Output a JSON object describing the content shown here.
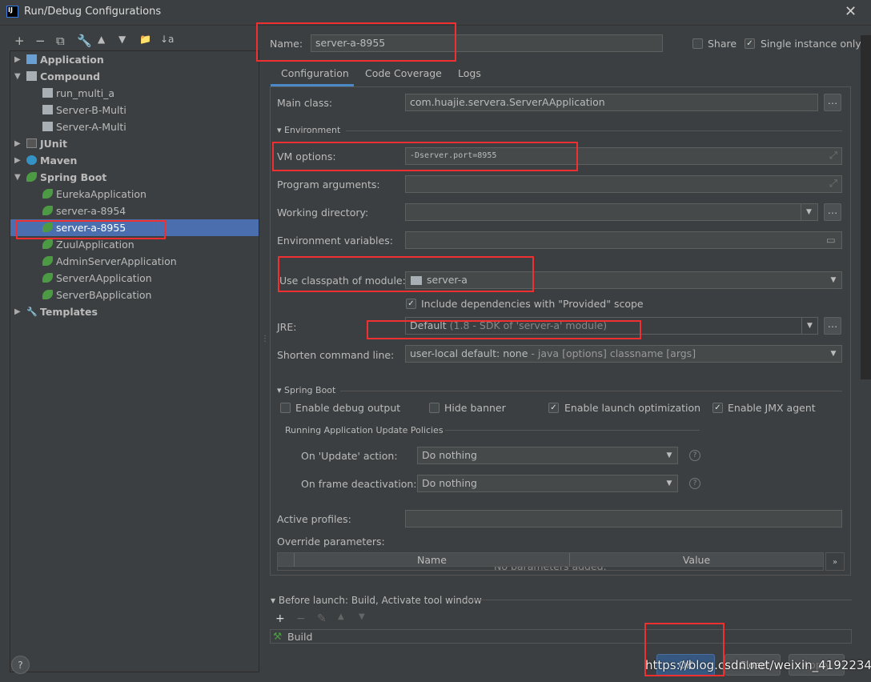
{
  "window": {
    "title": "Run/Debug Configurations",
    "logo": "IJ"
  },
  "toolbar": [
    "+",
    "−",
    "⧉",
    "🔧",
    "▲",
    "▼",
    "📁",
    "↓a"
  ],
  "tree": [
    {
      "label": "Application",
      "level": 0,
      "bold": true,
      "expanded": false,
      "icon": "application-icon"
    },
    {
      "label": "Compound",
      "level": 0,
      "bold": true,
      "expanded": true,
      "icon": "compound-icon"
    },
    {
      "label": "run_multi_a",
      "level": 1,
      "icon": "compound-icon"
    },
    {
      "label": "Server-B-Multi",
      "level": 1,
      "icon": "compound-icon"
    },
    {
      "label": "Server-A-Multi",
      "level": 1,
      "icon": "compound-icon"
    },
    {
      "label": "JUnit",
      "level": 0,
      "bold": true,
      "expanded": false,
      "icon": "junit-icon"
    },
    {
      "label": "Maven",
      "level": 0,
      "bold": true,
      "expanded": false,
      "icon": "maven-gear-icon"
    },
    {
      "label": "Spring Boot",
      "level": 0,
      "bold": true,
      "expanded": true,
      "icon": "spring-boot-icon"
    },
    {
      "label": "EurekaApplication",
      "level": 1,
      "icon": "spring-boot-icon"
    },
    {
      "label": "server-a-8954",
      "level": 1,
      "icon": "spring-boot-icon"
    },
    {
      "label": "server-a-8955",
      "level": 1,
      "icon": "spring-boot-icon",
      "selected": true
    },
    {
      "label": "ZuulApplication",
      "level": 1,
      "icon": "spring-boot-icon"
    },
    {
      "label": "AdminServerApplication",
      "level": 1,
      "icon": "spring-boot-icon"
    },
    {
      "label": "ServerAApplication",
      "level": 1,
      "icon": "spring-boot-icon"
    },
    {
      "label": "ServerBApplication",
      "level": 1,
      "icon": "spring-boot-icon"
    },
    {
      "label": "Templates",
      "level": 0,
      "bold": true,
      "expanded": false,
      "icon": "wrench-icon"
    }
  ],
  "header": {
    "name_label": "Name:",
    "name_value": "server-a-8955",
    "share_label": "Share",
    "share_checked": false,
    "single_label": "Single instance only",
    "single_checked": true
  },
  "tabs": [
    "Configuration",
    "Code Coverage",
    "Logs"
  ],
  "config": {
    "main_class_label": "Main class:",
    "main_class": "com.huajie.servera.ServerAApplication",
    "environment_section": "Environment",
    "vm_label": "VM options:",
    "vm_value": "-Dserver.port=8955",
    "args_label": "Program arguments:",
    "args_value": "",
    "workdir_label": "Working directory:",
    "workdir_value": "",
    "envvars_label": "Environment variables:",
    "envvars_value": "",
    "module_label": "Use classpath of module:",
    "module_value": "server-a",
    "provided_label": "Include dependencies with \"Provided\" scope",
    "provided_checked": true,
    "jre_label": "JRE:",
    "jre_value": "Default",
    "jre_hint": "(1.8 - SDK of 'server-a' module)",
    "shorten_label": "Shorten command line:",
    "shorten_value": "user-local default: none",
    "shorten_hint": "- java [options] classname [args]",
    "spring_section": "Spring Boot",
    "debug_label": "Enable debug output",
    "debug_checked": false,
    "banner_label": "Hide banner",
    "banner_checked": false,
    "launch_opt_label": "Enable launch optimization",
    "launch_opt_checked": true,
    "jmx_label": "Enable JMX agent",
    "jmx_checked": true,
    "policies_label": "Running Application Update Policies",
    "update_label": "On 'Update' action:",
    "update_value": "Do nothing",
    "frame_label": "On frame deactivation:",
    "frame_value": "Do nothing",
    "profiles_label": "Active profiles:",
    "profiles_value": "",
    "override_label": "Override parameters:",
    "table_headers": [
      "Name",
      "Value"
    ],
    "table_empty": "No parameters added."
  },
  "before_launch": {
    "label": "Before launch: Build, Activate tool window",
    "tools": [
      "+",
      "−",
      "✎",
      "▲",
      "▼"
    ],
    "items": [
      "Build"
    ]
  },
  "buttons": {
    "ok": "OK",
    "close": "Close",
    "apply": "Apply",
    "help": "?"
  },
  "watermark": "https://blog.csdn.net/weixin_41922349",
  "colors": {
    "background": "#3c3f41",
    "selection": "#4b6eaf",
    "annotation": "#f03030",
    "primary_button": "#365880"
  }
}
